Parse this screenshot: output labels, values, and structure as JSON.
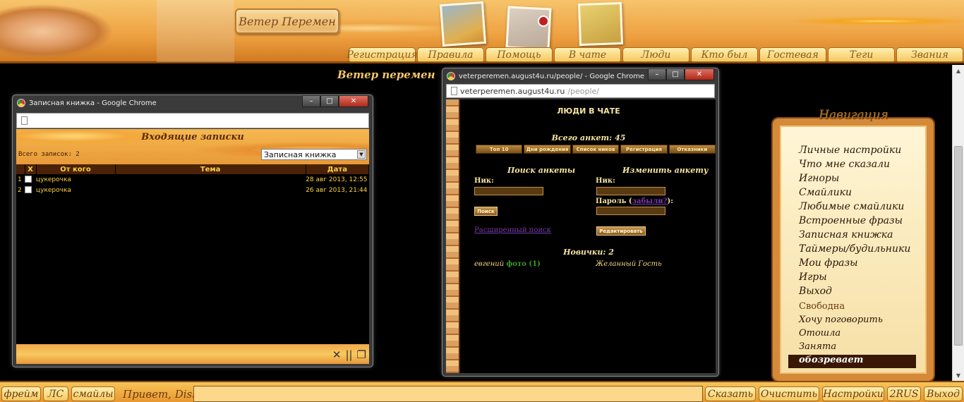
{
  "header": {
    "site_title": "Ветер Перемен",
    "nav": [
      "Регистрация",
      "Правила",
      "Помощь",
      "В чате",
      "Люди",
      "Кто был",
      "Гостевая",
      "Теги",
      "Звания"
    ]
  },
  "page_title": "Ветер перемен",
  "notebook_window": {
    "title": "Записная книжка - Google Chrome",
    "heading": "Входящие записки",
    "total": "Всего записок: 2",
    "select_value": "Записная книжка",
    "columns": [
      "X",
      "От кого",
      "Тема",
      "Дата"
    ],
    "rows": [
      {
        "n": "1",
        "from": "цукерочка",
        "subject": "",
        "date": "28 авг 2013, 12:55"
      },
      {
        "n": "2",
        "from": "цукерочка",
        "subject": "",
        "date": "26 авг 2013, 21:44"
      }
    ]
  },
  "people_window": {
    "title": "veterperemen.august4u.ru/people/ - Google Chrome",
    "url_host": "veterperemen.august4u.ru",
    "url_path": "/people/",
    "heading": "ЛЮДИ В ЧАТЕ",
    "total": "Всего анкет: 45",
    "tabs": [
      "Топ 10",
      "Дни рождения",
      "Список ников",
      "Регистрация",
      "Отказники"
    ],
    "search_title": "Поиск анкеты",
    "edit_title": "Изменить анкету",
    "nick_label": "Ник:",
    "password_label": "Пароль (",
    "forgot_label": "забыли?",
    "password_suffix": "):",
    "search_button": "Поиск",
    "advanced_search": "Расширенный поиск",
    "edit_button": "Редактировать",
    "newbies": "Новички: 2",
    "newbie1_name": "евгений",
    "newbie1_photo": "фото (1)",
    "newbie2_name": "Желанный Гость"
  },
  "navigation": {
    "title": "Навигация",
    "items": [
      "Личные настройки",
      "Что мне сказали",
      "Игноры",
      "Смайлики",
      "Любимые смайлики",
      "Встроенные фразы",
      "Записная книжка",
      "Таймеры/будильники",
      "Мои фразы",
      "Игры",
      "Выход"
    ],
    "statuses": [
      "Свободна",
      "Хочу поговорить",
      "Отошла",
      "Занята",
      "обозревает"
    ]
  },
  "bottom_bar": {
    "left_buttons": [
      "фрейм",
      "ЛС",
      "смайлы"
    ],
    "greeting": "Привет, Dish!",
    "right_buttons": [
      "Сказать",
      "Очистить",
      "Настройки",
      "2RUS",
      "Выход"
    ]
  }
}
